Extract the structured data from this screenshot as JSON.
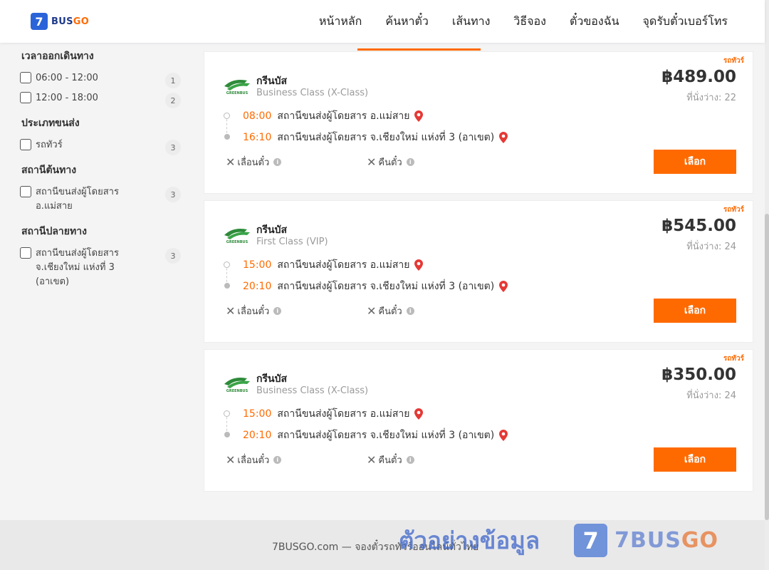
{
  "header": {
    "logo_number": "7",
    "logo_text": "BUS",
    "logo_go": "GO",
    "nav": [
      "หน้าหลัก",
      "ค้นหาตั๋ว",
      "เส้นทาง",
      "วิธีจอง",
      "ตั๋วของฉัน",
      "จุดรับตั๋วเบอร์โทร"
    ]
  },
  "filters": [
    {
      "title": "เวลาออกเดินทาง",
      "options": [
        {
          "label": "06:00 - 12:00",
          "count": "1"
        },
        {
          "label": "12:00 - 18:00",
          "count": "2"
        }
      ]
    },
    {
      "title": "ประเภทขนส่ง",
      "options": [
        {
          "label": "รถทัวร์",
          "count": "3"
        }
      ]
    },
    {
      "title": "สถานีต้นทาง",
      "options": [
        {
          "label": "สถานีขนส่งผู้โดยสาร อ.แม่สาย",
          "count": "3"
        }
      ]
    },
    {
      "title": "สถานีปลายทาง",
      "options": [
        {
          "label": "สถานีขนส่งผู้โดยสาร จ.เชียงใหม่ แห่งที่ 3 (อาเขต)",
          "count": "3"
        }
      ]
    }
  ],
  "trips": [
    {
      "type_tag": "รถทัวร์",
      "operator": "กรีนบัส",
      "bus_class": "Business Class (X-Class)",
      "price": "฿489.00",
      "seats": "ที่นั่งว่าง: 22",
      "depart_time": "08:00",
      "depart_station": "สถานีขนส่งผู้โดยสาร อ.แม่สาย",
      "arrive_time": "16:10",
      "arrive_station": "สถานีขนส่งผู้โดยสาร จ.เชียงใหม่ แห่งที่ 3 (อาเขต)",
      "policy_change": "เลื่อนตั๋ว",
      "policy_refund": "คืนตั๋ว",
      "select_label": "เลือก"
    },
    {
      "type_tag": "รถทัวร์",
      "operator": "กรีนบัส",
      "bus_class": "First Class (VIP)",
      "price": "฿545.00",
      "seats": "ที่นั่งว่าง: 24",
      "depart_time": "15:00",
      "depart_station": "สถานีขนส่งผู้โดยสาร อ.แม่สาย",
      "arrive_time": "20:10",
      "arrive_station": "สถานีขนส่งผู้โดยสาร จ.เชียงใหม่ แห่งที่ 3 (อาเขต)",
      "policy_change": "เลื่อนตั๋ว",
      "policy_refund": "คืนตั๋ว",
      "select_label": "เลือก"
    },
    {
      "type_tag": "รถทัวร์",
      "operator": "กรีนบัส",
      "bus_class": "Business Class (X-Class)",
      "price": "฿350.00",
      "seats": "ที่นั่งว่าง: 24",
      "depart_time": "15:00",
      "depart_station": "สถานีขนส่งผู้โดยสาร อ.แม่สาย",
      "arrive_time": "20:10",
      "arrive_station": "สถานีขนส่งผู้โดยสาร จ.เชียงใหม่ แห่งที่ 3 (อาเขต)",
      "policy_change": "เลื่อนตั๋ว",
      "policy_refund": "คืนตั๋ว",
      "select_label": "เลือก"
    }
  ],
  "footer": {
    "text": "7BUSGO.com — จองตั๋วรถทัวร์ออนไลน์ทั่วไทย"
  },
  "watermark": {
    "text": "ตัวอย่างข้อมูล",
    "box_number": "7",
    "brand": "7BUS",
    "brand_go": "GO"
  },
  "colors": {
    "accent": "#ff6a00",
    "brand_blue": "#2a64d8",
    "greenbus": "#2e8b3a"
  }
}
